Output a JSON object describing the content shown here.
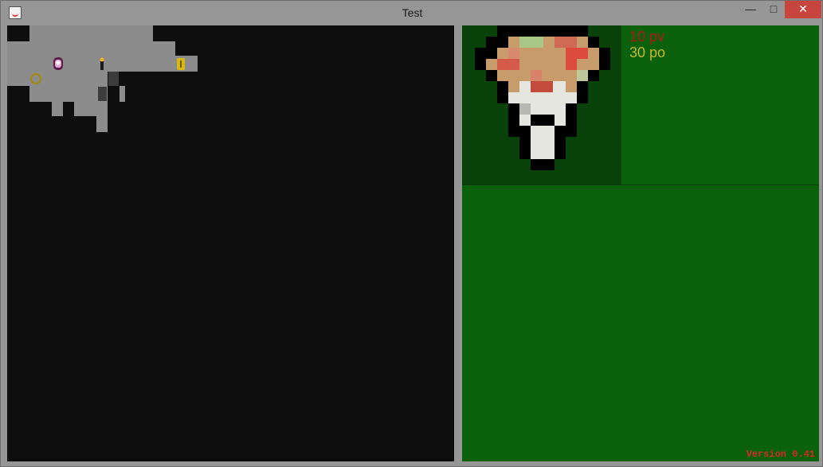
{
  "window": {
    "title": "Test",
    "controls": {
      "minimize": "—",
      "maximize": "□",
      "close": "✕"
    },
    "icon": "java-cup-icon"
  },
  "map": {
    "background": "#0e0e0e",
    "floor_color": "#8c8c8c",
    "entities": [
      {
        "name": "princess-sprite",
        "icon": "princess-icon"
      },
      {
        "name": "torch-sprite",
        "icon": "torch-icon"
      },
      {
        "name": "gold-coin-sprite",
        "icon": "coin-icon"
      },
      {
        "name": "ring-sprite",
        "icon": "ring-icon"
      },
      {
        "name": "rock-tile",
        "icon": "rock-icon"
      },
      {
        "name": "rock-tile",
        "icon": "rock-icon"
      }
    ]
  },
  "player": {
    "hp_label": "10 pv",
    "gold_label": "30 po",
    "portrait_icon": "mushroom-character-icon"
  },
  "footer": {
    "version": "Version 0.41"
  },
  "colors": {
    "panel_green": "#0c620c",
    "portrait_bg": "#094209",
    "hp_color": "#b01818",
    "gold_color": "#c6b52a",
    "version_color": "#d42828"
  }
}
